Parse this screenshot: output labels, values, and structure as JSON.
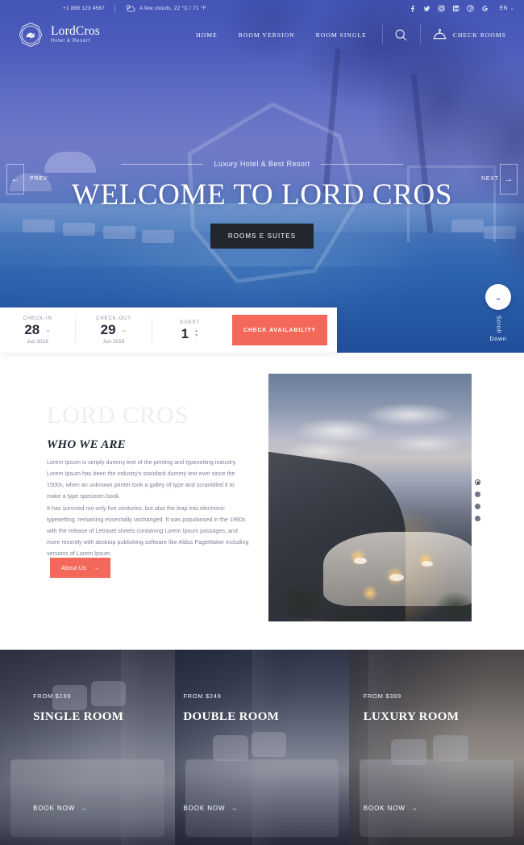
{
  "topbar": {
    "phone": "+1 888 123 4567",
    "weather_icon": "cloud-sun-icon",
    "weather": "A few clouds, 22 °C / 71 °F",
    "socials": [
      {
        "name": "facebook-icon",
        "glyph": "f"
      },
      {
        "name": "twitter-icon",
        "glyph": "t"
      },
      {
        "name": "instagram-icon",
        "glyph": "i"
      },
      {
        "name": "linkedin-icon",
        "glyph": "in"
      },
      {
        "name": "pinterest-icon",
        "glyph": "p"
      },
      {
        "name": "google-plus-icon",
        "glyph": "G"
      }
    ],
    "language": "EN",
    "language_chevron": "⌄"
  },
  "brand": {
    "emblem": "lion-emblem-icon",
    "name": "LordCros",
    "tagline": "Hotel & Resort"
  },
  "nav": {
    "items": [
      {
        "label": "HOME"
      },
      {
        "label": "ROOM VERSION"
      },
      {
        "label": "ROOM SINGLE"
      }
    ],
    "search_icon": "search-icon",
    "bell_icon": "service-bell-icon",
    "check_rooms_label": "CHECK ROOMS"
  },
  "hero": {
    "eyebrow": "Luxury Hotel & Best Resort",
    "title": "WELCOME TO LORD CROS",
    "button_label": "ROOMS E SUITES",
    "prev_label": "PREV",
    "prev_icon": "arrow-left-icon",
    "next_label": "NEXT",
    "next_icon": "arrow-right-icon",
    "scroll_icon": "chevron-down-icon",
    "scroll_label_1": "Scroll",
    "scroll_label_2": "Down"
  },
  "booking": {
    "checkin": {
      "label": "CHECK-IN",
      "day": "28",
      "month_year": "Jun 2019",
      "chevron": "⌄"
    },
    "checkout": {
      "label": "CHECK-OUT",
      "day": "29",
      "month_year": "Jun 2019",
      "chevron": "⌄"
    },
    "guest": {
      "label": "GUEST",
      "value": "1",
      "up": "▲",
      "down": "▼"
    },
    "cta_label": "CHECK AVAILABILITY",
    "cta_color": "#f4685c"
  },
  "about": {
    "watermark": "LORD CROS",
    "heading": "WHO WE ARE",
    "paragraph1": "Lorem Ipsum is simply dummy text of the printing and typesetting industry. Lorem Ipsum has been the industry's standard dummy text ever since the 1500s, when an unknown printer took a galley of type and scrambled it to make a type specimen book.",
    "paragraph2": "It has survived not only five centuries, but also the leap into electronic typesetting, remaining essentially unchanged. It was popularised in the 1960s with the release of Letraset sheets containing Lorem Ipsum passages, and more recently with desktop publishing software like Aldus PageMaker including versions of Lorem Ipsum.",
    "button_label": "About Us",
    "button_arrow": "→",
    "slider_dots": 4,
    "slider_active_index": 0
  },
  "rooms": [
    {
      "price": "FROM $199",
      "title": "SINGLE ROOM",
      "book_label": "BOOK NOW",
      "book_arrow": "→"
    },
    {
      "price": "FROM $249",
      "title": "DOUBLE ROOM",
      "book_label": "BOOK NOW",
      "book_arrow": "→"
    },
    {
      "price": "FROM $389",
      "title": "LUXURY ROOM",
      "book_label": "BOOK NOW",
      "book_arrow": "→"
    }
  ]
}
